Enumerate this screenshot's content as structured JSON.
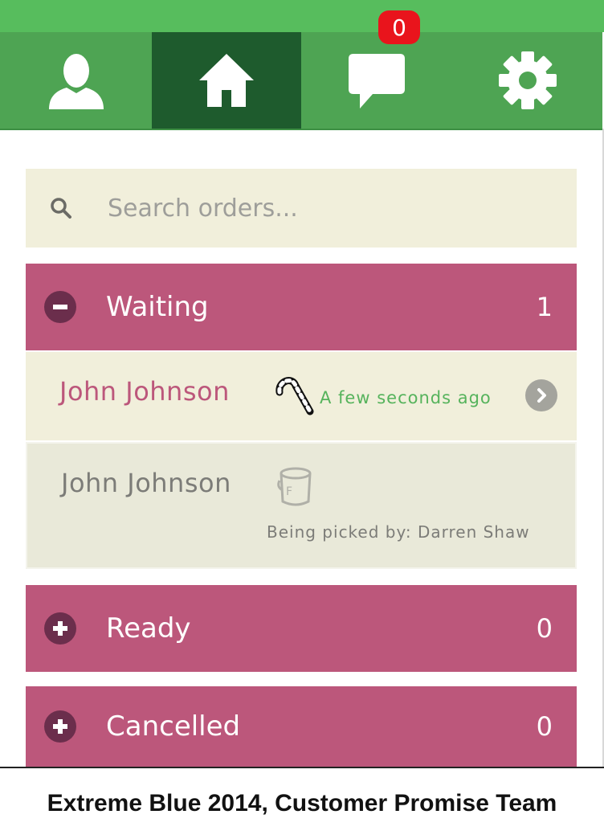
{
  "nav": {
    "tabs": [
      {
        "name": "profile",
        "icon": "person-icon",
        "active": false
      },
      {
        "name": "home",
        "icon": "home-icon",
        "active": true
      },
      {
        "name": "messages",
        "icon": "chat-bubble-icon",
        "active": false
      },
      {
        "name": "settings",
        "icon": "gear-icon",
        "active": false
      }
    ],
    "message_badge": "0"
  },
  "search": {
    "placeholder": "Search orders...",
    "value": ""
  },
  "sections": [
    {
      "title": "Waiting",
      "count": "1",
      "expanded": true,
      "toggle_icon": "minus-circle-icon"
    },
    {
      "title": "Ready",
      "count": "0",
      "expanded": false,
      "toggle_icon": "plus-circle-icon"
    },
    {
      "title": "Cancelled",
      "count": "0",
      "expanded": false,
      "toggle_icon": "plus-circle-icon"
    }
  ],
  "orders": [
    {
      "customer": "John Johnson",
      "icon": "candy-cane-icon",
      "time": "A few seconds ago"
    },
    {
      "customer": "John Johnson",
      "icon": "paint-bucket-icon",
      "picker": "Being picked by: Darren Shaw"
    }
  ],
  "footer": {
    "text": "Extreme Blue 2014, Customer Promise Team"
  },
  "colors": {
    "nav_green": "#4ea453",
    "nav_active": "#1e5b2d",
    "section_pink": "#bc577b",
    "row_beige": "#f1efdb",
    "time_green": "#56b35c",
    "badge_red": "#e9141c"
  }
}
